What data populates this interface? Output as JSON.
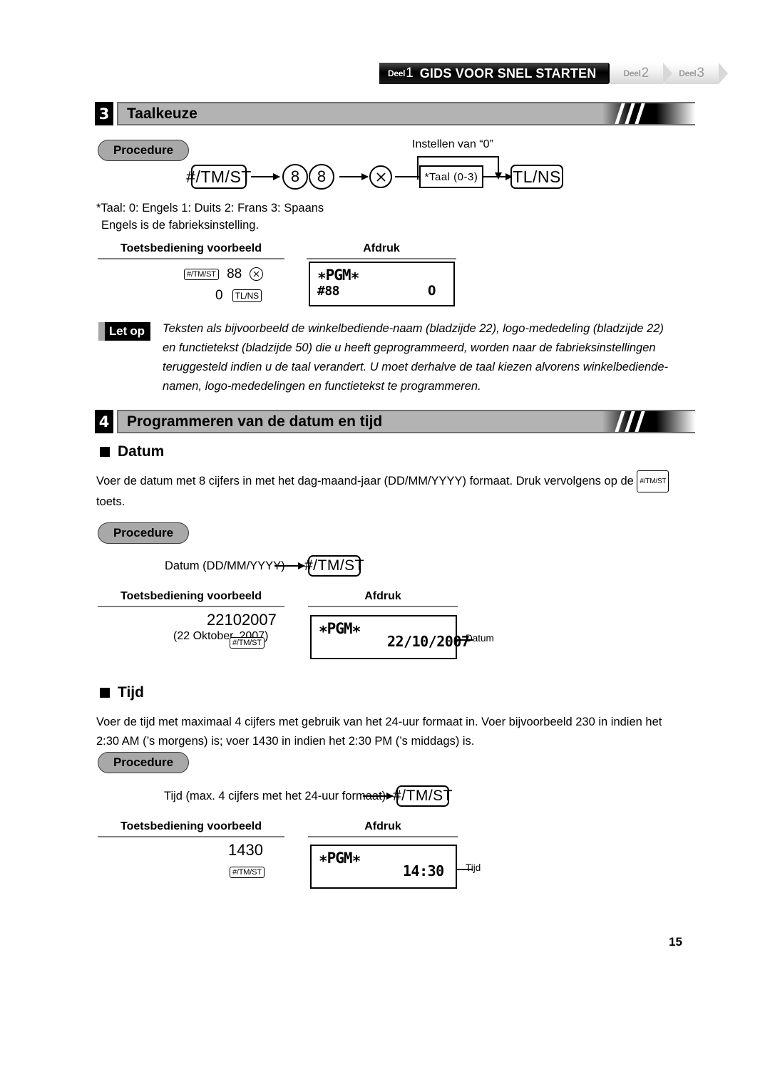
{
  "header": {
    "tabs": [
      {
        "deel_label": "Deel",
        "number": "1",
        "title": "GIDS VOOR SNEL STARTEN",
        "active": true
      },
      {
        "deel_label": "Deel",
        "number": "2",
        "title": "",
        "active": false
      },
      {
        "deel_label": "Deel",
        "number": "3",
        "title": "",
        "active": false
      }
    ]
  },
  "section3": {
    "number": "3",
    "title": "Taalkeuze",
    "procedure_label": "Procedure",
    "flow": {
      "key1": "#/TM/ST",
      "digit1": "8",
      "digit2": "8",
      "multiply_icon": "multiply-key-icon",
      "caption_top": "Instellen van “0”",
      "param_box": "*Taal (0-3)",
      "key_end": "TL/NS"
    },
    "footnote_line1": "*Taal: 0: Engels     1: Duits     2: Frans     3: Spaans",
    "footnote_line2": "Engels is de fabrieksinstelling.",
    "example": {
      "col1_head": "Toetsbediening voorbeeld",
      "col2_head": "Afdruk",
      "keys_row1_key": "#/TM/ST",
      "keys_row1_value": "88",
      "keys_row2_value": "0",
      "keys_row2_key": "TL/NS",
      "receipt_title": "∗PGM∗",
      "receipt_left": "#88",
      "receipt_right": "O"
    }
  },
  "note": {
    "badge": "Let op",
    "text": "Teksten als bijvoorbeeld de winkelbediende-naam (bladzijde 22), logo-mededeling (bladzijde 22) en functietekst (bladzijde 50) die u heeft geprogrammeerd, worden naar de fabrieksinstellingen teruggesteld indien u de taal verandert. U moet derhalve de taal kiezen alvorens winkelbediende-namen, logo-mededelingen en functietekst te programmeren."
  },
  "section4": {
    "number": "4",
    "title": "Programmeren van de datum en tijd",
    "datum": {
      "sub_title": "Datum",
      "paragraph_part1": "Voer de datum met 8 cijfers in met het dag-maand-jaar (DD/MM/YYYY) formaat. Druk vervolgens op de",
      "inline_key": "#/TM/ST",
      "paragraph_part2": "toets.",
      "procedure_label": "Procedure",
      "flow_label": "Datum (DD/MM/YYYY)",
      "flow_key": "#/TM/ST",
      "example": {
        "col1_head": "Toetsbediening voorbeeld",
        "col2_head": "Afdruk",
        "entry_value": "22102007",
        "entry_note": "(22 Oktober, 2007)",
        "entry_key": "#/TM/ST",
        "receipt_title": "∗PGM∗",
        "receipt_value": "22/10/2007",
        "callout": "Datum"
      }
    },
    "tijd": {
      "sub_title": "Tijd",
      "paragraph": "Voer de tijd met maximaal 4 cijfers met gebruik van het 24-uur formaat in. Voer bijvoorbeeld 230 in indien het 2:30 AM (’s morgens) is; voer 1430 in indien het 2:30 PM (’s middags) is.",
      "procedure_label": "Procedure",
      "flow_label": "Tijd (max. 4 cijfers met het 24-uur formaat)",
      "flow_key": "#/TM/ST",
      "example": {
        "col1_head": "Toetsbediening voorbeeld",
        "col2_head": "Afdruk",
        "entry_value": "1430",
        "entry_key": "#/TM/ST",
        "receipt_title": "∗PGM∗",
        "receipt_value": "14:30",
        "callout": "Tijd"
      }
    }
  },
  "footer": {
    "page_number": "15"
  },
  "colors": {
    "bar_gray": "#b3b3b3",
    "pill_gray": "#a8a8a8",
    "rule_gray": "#808080",
    "black": "#000000"
  }
}
